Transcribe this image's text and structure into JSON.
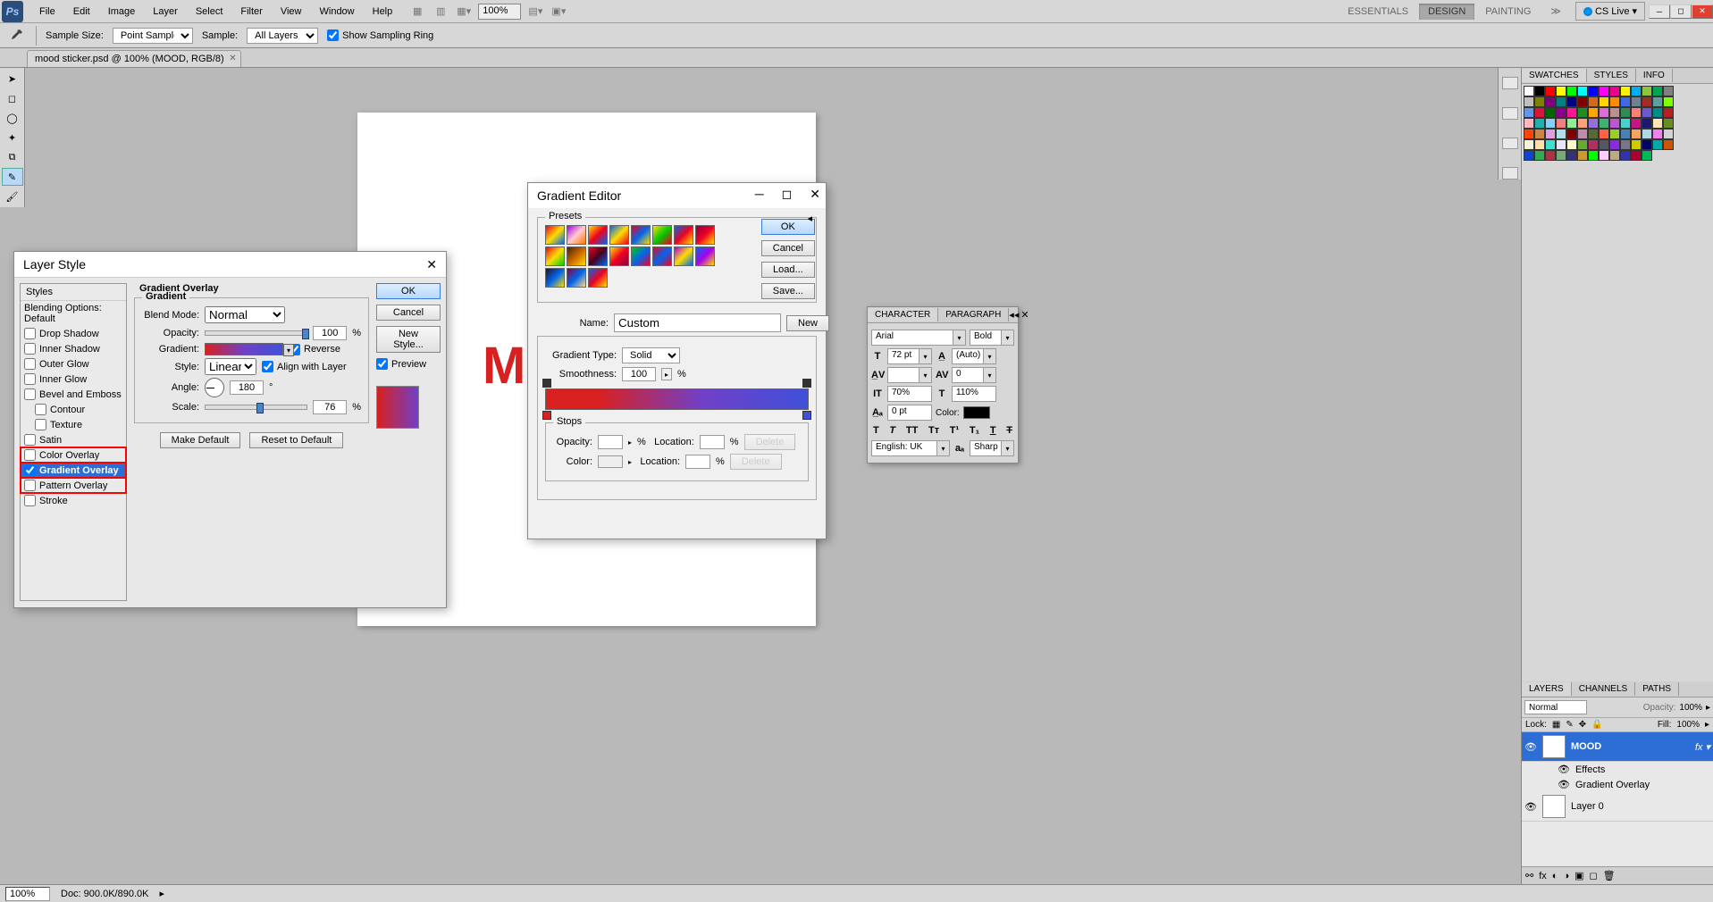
{
  "menubar": {
    "items": [
      "File",
      "Edit",
      "Image",
      "Layer",
      "Select",
      "Filter",
      "View",
      "Window",
      "Help"
    ],
    "zoom": "100%",
    "workspaces": [
      "ESSENTIALS",
      "DESIGN",
      "PAINTING"
    ],
    "active_ws": 1,
    "cslive": "CS Live"
  },
  "options": {
    "sample_size_label": "Sample Size:",
    "sample_size": "Point Sample",
    "sample_label": "Sample:",
    "sample": "All Layers",
    "show_ring": "Show Sampling Ring"
  },
  "doc_tab": "mood sticker.psd @ 100% (MOOD, RGB/8)",
  "canvas_text": "M",
  "status": {
    "zoom": "100%",
    "doc": "Doc: 900.0K/890.0K"
  },
  "layerstyle": {
    "title": "Layer Style",
    "styles_hdr": "Styles",
    "blending_default": "Blending Options: Default",
    "fx": [
      "Drop Shadow",
      "Inner Shadow",
      "Outer Glow",
      "Inner Glow",
      "Bevel and Emboss",
      "Contour",
      "Texture",
      "Satin",
      "Color Overlay",
      "Gradient Overlay",
      "Pattern Overlay",
      "Stroke"
    ],
    "selected_fx": "Gradient Overlay",
    "panel_title": "Gradient Overlay",
    "group_title": "Gradient",
    "blendmode_label": "Blend Mode:",
    "blendmode": "Normal",
    "opacity_label": "Opacity:",
    "opacity": "100",
    "gradient_label": "Gradient:",
    "reverse": "Reverse",
    "style_label": "Style:",
    "style": "Linear",
    "align": "Align with Layer",
    "angle_label": "Angle:",
    "angle": "180",
    "scale_label": "Scale:",
    "scale": "76",
    "make_default": "Make Default",
    "reset_default": "Reset to Default",
    "ok": "OK",
    "cancel": "Cancel",
    "newstyle": "New Style...",
    "preview": "Preview"
  },
  "gradeditor": {
    "title": "Gradient Editor",
    "presets_label": "Presets",
    "name_label": "Name:",
    "name": "Custom",
    "type_label": "Gradient Type:",
    "type": "Solid",
    "smooth_label": "Smoothness:",
    "smooth": "100",
    "stops_label": "Stops",
    "opacity_label": "Opacity:",
    "location_label": "Location:",
    "color_label": "Color:",
    "delete": "Delete",
    "ok": "OK",
    "cancel": "Cancel",
    "load": "Load...",
    "save": "Save...",
    "new": "New"
  },
  "char": {
    "tab1": "CHARACTER",
    "tab2": "PARAGRAPH",
    "font": "Arial",
    "weight": "Bold",
    "size": "72 pt",
    "leading": "(Auto)",
    "kerning": "",
    "tracking": "0",
    "vscale": "70%",
    "hscale": "110%",
    "baseline": "0 pt",
    "color_label": "Color:",
    "lang": "English: UK",
    "aa": "Sharp"
  },
  "rightpanels": {
    "swatches_tabs": [
      "SWATCHES",
      "STYLES",
      "INFO"
    ],
    "layers_tabs": [
      "LAYERS",
      "CHANNELS",
      "PATHS"
    ],
    "blend": "Normal",
    "opacity_label": "Opacity:",
    "opacity": "100%",
    "lock_label": "Lock:",
    "fill_label": "Fill:",
    "fill": "100%",
    "layer_mood": "MOOD",
    "fx_label": "Effects",
    "fx_grad": "Gradient Overlay",
    "layer0": "Layer 0"
  },
  "swatch_colors": [
    "#fff",
    "#000",
    "#f00",
    "#ff0",
    "#0f0",
    "#0ff",
    "#00f",
    "#f0f",
    "#ec008c",
    "#fff200",
    "#00aeef",
    "#8dc63e",
    "#00a651",
    "#808080",
    "#c0c0c0",
    "#808000",
    "#800080",
    "#008080",
    "#000080",
    "#800000",
    "#d2691e",
    "#ffd700",
    "#ff8c00",
    "#4169e1",
    "#708090",
    "#a52a2a",
    "#5f9ea0",
    "#7fff00",
    "#6495ed",
    "#dc143c",
    "#006400",
    "#8b008b",
    "#ff1493",
    "#228b22",
    "#ffa500",
    "#da70d6",
    "#bc8f8f",
    "#2e8b57",
    "#fa8072",
    "#6a5acd",
    "#008b8b",
    "#b22222",
    "#ffb6c1",
    "#20b2aa",
    "#87cefa",
    "#f08080",
    "#90ee90",
    "#ffa07a",
    "#9370db",
    "#3cb371",
    "#ba55d3",
    "#48d1cc",
    "#c71585",
    "#191970",
    "#ffe4b5",
    "#6b8e23",
    "#ff4500",
    "#cd853f",
    "#dda0dd",
    "#b0e0e6",
    "#800000",
    "#bc8cac",
    "#556b2f",
    "#ff6347",
    "#9acd32",
    "#4682b4",
    "#f4a460",
    "#add8e6",
    "#ee82ee",
    "#d3d3d3",
    "#f5f5dc",
    "#ffdead",
    "#40e0d0",
    "#e6e6fa",
    "#fffacd",
    "#6a3",
    "#b03060",
    "#556",
    "#8a2be2",
    "#778",
    "#cc0",
    "#006",
    "#0aa",
    "#cc5500",
    "#14c",
    "#3a5",
    "#a34",
    "#7a7",
    "#337",
    "#c93",
    "#0f0",
    "#fcf",
    "#ba8",
    "#33a",
    "#a03",
    "#0b5"
  ]
}
